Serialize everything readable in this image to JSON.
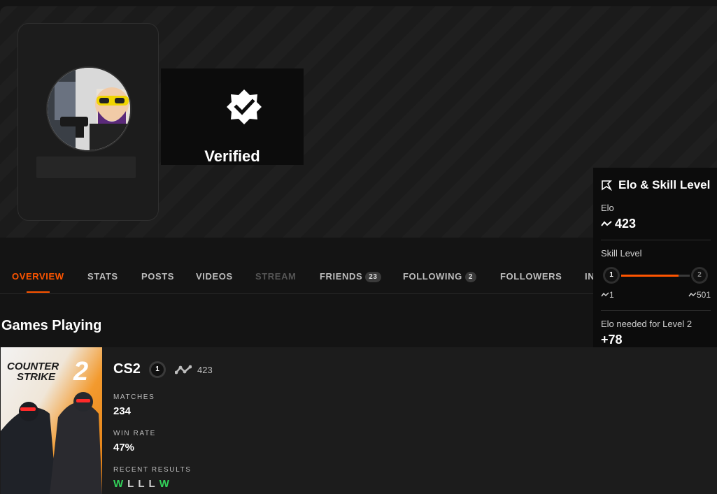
{
  "profile": {
    "verified_label": "Verified"
  },
  "tabs": [
    {
      "label": "OVERVIEW"
    },
    {
      "label": "STATS"
    },
    {
      "label": "POSTS"
    },
    {
      "label": "VIDEOS"
    },
    {
      "label": "STREAM"
    },
    {
      "label": "FRIENDS",
      "badge": "23"
    },
    {
      "label": "FOLLOWING",
      "badge": "2"
    },
    {
      "label": "FOLLOWERS"
    },
    {
      "label": "IN"
    }
  ],
  "games_section": {
    "title": "Games Playing"
  },
  "game": {
    "cover_text_line1": "COUNTER",
    "cover_text_line2": "STRIKE",
    "cover_number": "2",
    "name": "CS2",
    "level": "1",
    "elo": "423",
    "matches_label": "MATCHES",
    "matches_value": "234",
    "win_rate_label": "WIN RATE",
    "win_rate_value": "47%",
    "recent_label": "RECENT RESULTS",
    "recent_results": [
      "W",
      "L",
      "L",
      "L",
      "W"
    ]
  },
  "elo_panel": {
    "title": "Elo & Skill Level",
    "elo_label": "Elo",
    "elo_value": "423",
    "skill_label": "Skill Level",
    "level_from": "1",
    "level_to": "2",
    "elo_min": "1",
    "elo_max": "501",
    "progress_fraction": 0.84,
    "needed_label": "Elo needed for Level 2",
    "needed_value": "+78"
  },
  "colors": {
    "accent": "#ff5500",
    "win": "#32d35a",
    "loss": "#cfcfcf"
  }
}
